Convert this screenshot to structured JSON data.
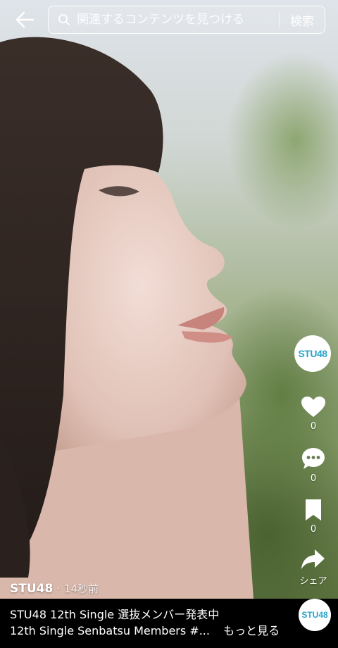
{
  "search": {
    "placeholder": "関連するコンテンツを見つける",
    "button_label": "検索"
  },
  "rail": {
    "avatar_text": "STU48",
    "like_count": "0",
    "comment_count": "0",
    "bookmark_count": "0",
    "share_label": "シェア"
  },
  "post": {
    "author": "STU48",
    "separator": "·",
    "time": "14秒前",
    "title": "STU48 12th Single 選抜メンバー発表中",
    "description": "12th Single Senbatsu Members #...",
    "more_label": "もっと見る"
  },
  "colors": {
    "brand": "#2aa3c9",
    "icon": "#ffffff"
  }
}
